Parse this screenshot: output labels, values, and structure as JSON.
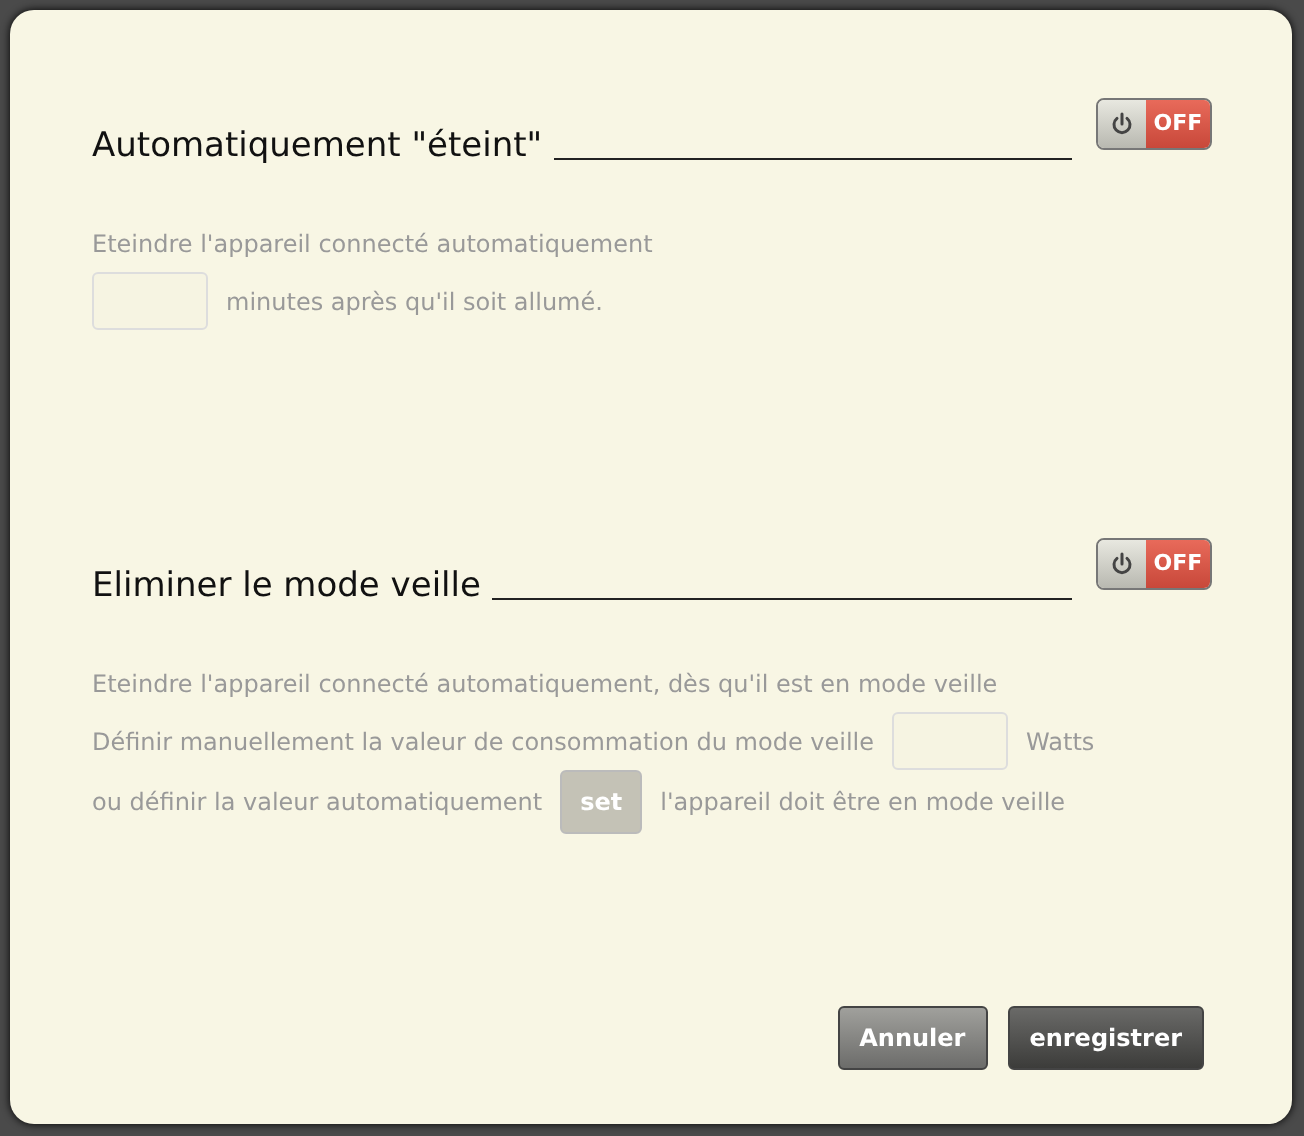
{
  "sections": [
    {
      "title": "Automatiquement \"éteint\"",
      "toggle": {
        "on": false,
        "label": "OFF"
      },
      "lines": [
        [
          {
            "kind": "text",
            "text": "Eteindre l'appareil connecté automatiquement"
          }
        ],
        [
          {
            "kind": "input"
          },
          {
            "kind": "text",
            "text": "minutes après qu'il soit allumé."
          }
        ]
      ]
    },
    {
      "title": "Eliminer le mode veille",
      "toggle": {
        "on": false,
        "label": "OFF"
      },
      "lines": [
        [
          {
            "kind": "text",
            "text": "Eteindre l'appareil connecté automatiquement, dès qu'il est en mode veille"
          }
        ],
        [
          {
            "kind": "text",
            "text": "Définir manuellement la valeur de consommation du mode veille"
          },
          {
            "kind": "input"
          },
          {
            "kind": "text",
            "text": "Watts"
          }
        ],
        [
          {
            "kind": "text",
            "text": "ou définir la valeur automatiquement"
          },
          {
            "kind": "button",
            "text": "set",
            "disabled": true
          },
          {
            "kind": "text",
            "text": "l'appareil doit être en mode veille"
          }
        ]
      ]
    }
  ],
  "buttons": [
    {
      "text": "Annuler",
      "kind": "cancel"
    },
    {
      "text": "enregistrer",
      "kind": "save"
    }
  ]
}
